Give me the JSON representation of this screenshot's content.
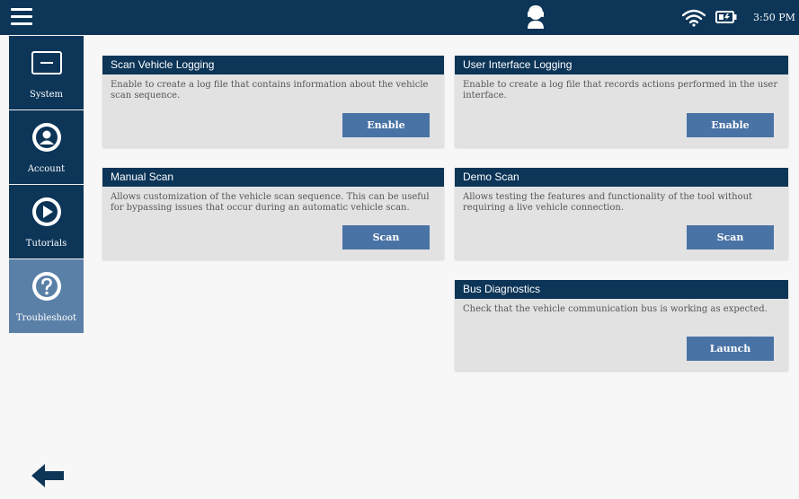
{
  "status_bar": {
    "time": "3:50 PM"
  },
  "sidebar": {
    "items": [
      {
        "label": "System",
        "icon": "monitor-icon",
        "active": false
      },
      {
        "label": "Account",
        "icon": "user-circle-icon",
        "active": false
      },
      {
        "label": "Tutorials",
        "icon": "play-circle-icon",
        "active": false
      },
      {
        "label": "Troubleshoot",
        "icon": "question-circle-icon",
        "active": true
      }
    ]
  },
  "cards": {
    "scan_vehicle_logging": {
      "title": "Scan Vehicle Logging",
      "description": "Enable to create a log file that contains information about the vehicle scan sequence.",
      "button": "Enable"
    },
    "user_interface_logging": {
      "title": "User Interface Logging",
      "description": "Enable to create a log file that records actions performed in the user interface.",
      "button": "Enable"
    },
    "manual_scan": {
      "title": "Manual Scan",
      "description": "Allows customization of the vehicle scan sequence. This can be useful for bypassing issues that occur during an automatic vehicle scan.",
      "button": "Scan"
    },
    "demo_scan": {
      "title": "Demo Scan",
      "description": "Allows testing the features and functionality of the tool without requiring a live vehicle connection.",
      "button": "Scan"
    },
    "bus_diagnostics": {
      "title": "Bus Diagnostics",
      "description": "Check that the vehicle communication bus is working as expected.",
      "button": "Launch"
    }
  },
  "colors": {
    "header_navy": "#0c3558",
    "active_tab": "#5b80a8",
    "button_blue": "#4a73a5",
    "card_gray": "#e2e2e2"
  }
}
